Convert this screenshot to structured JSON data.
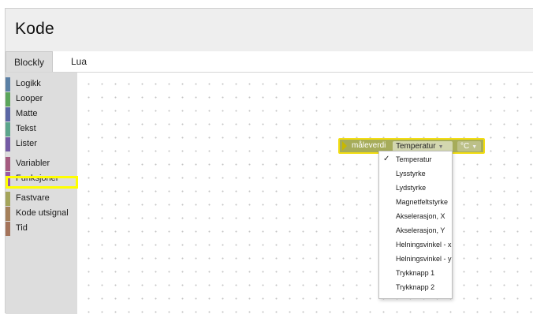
{
  "app": {
    "title": "Kode"
  },
  "tabs": [
    {
      "label": "Blockly",
      "active": true
    },
    {
      "label": "Lua",
      "active": false
    }
  ],
  "toolbox": {
    "categories": [
      {
        "label": "Logikk",
        "color": "#5b80a5"
      },
      {
        "label": "Looper",
        "color": "#5ba55b"
      },
      {
        "label": "Matte",
        "color": "#5b67a5"
      },
      {
        "label": "Tekst",
        "color": "#5ba58c"
      },
      {
        "label": "Lister",
        "color": "#745ba5"
      },
      {
        "label": "Variabler",
        "color": "#a55b80"
      },
      {
        "label": "Funksjoner",
        "color": "#995ba5"
      },
      {
        "label": "Fastvare",
        "color": "#a5a55b"
      },
      {
        "label": "Kode utsignal",
        "color": "#a5805b"
      },
      {
        "label": "Tid",
        "color": "#a5745b"
      }
    ],
    "highlighted": "Fastvare",
    "highlight_color": "#ffff00"
  },
  "block": {
    "label": "måleverdi",
    "sensor_value": "Temperatur",
    "unit_value": "°C",
    "color": "#a6ac5a",
    "selection_color": "#f2dd12"
  },
  "dropdown": {
    "selected": "Temperatur",
    "options": [
      "Temperatur",
      "Lysstyrke",
      "Lydstyrke",
      "Magnetfeltstyrke",
      "Akselerasjon, X",
      "Akselerasjon, Y",
      "Helningsvinkel - x",
      "Helningsvinkel - y",
      "Trykknapp 1",
      "Trykknapp 2"
    ]
  },
  "icons": {
    "check": "check-icon",
    "caret": "chevron-down-icon"
  }
}
